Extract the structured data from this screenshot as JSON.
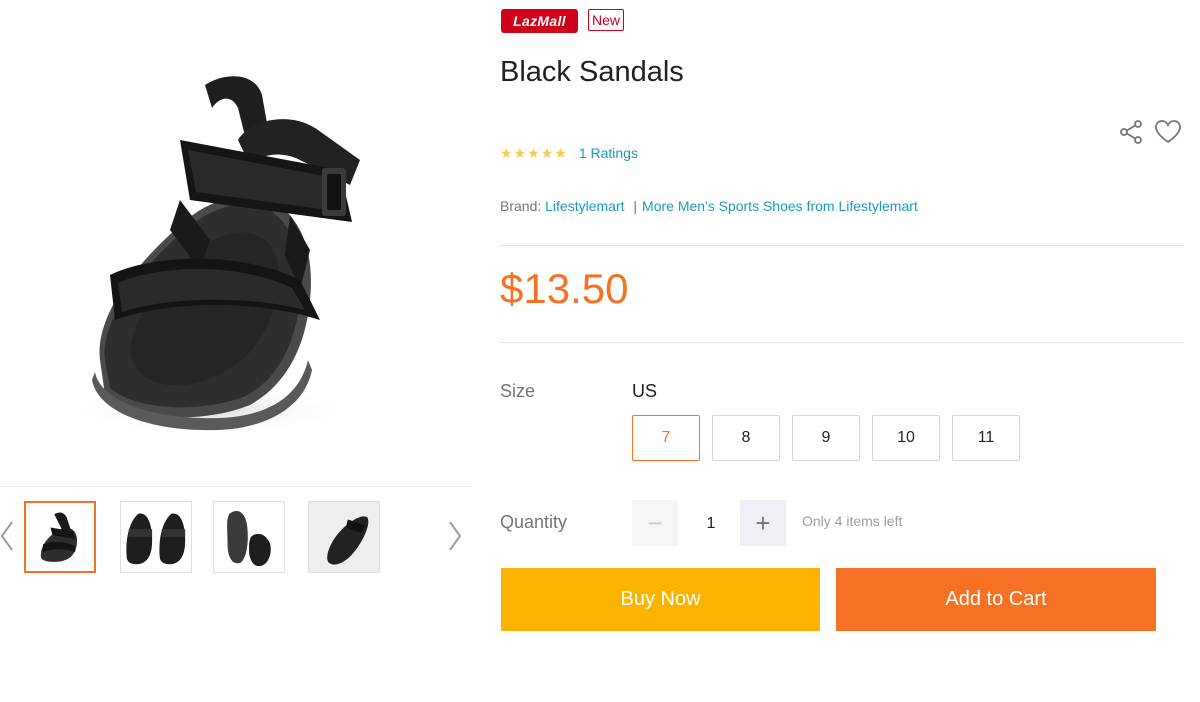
{
  "badges": {
    "lazmall": "LazMall",
    "new": "New"
  },
  "product": {
    "title": "Black Sandals",
    "rating_count": "1 Ratings",
    "stars": 5,
    "brand_label": "Brand:",
    "brand_name": "Lifestylemart",
    "brand_separator": "|",
    "more_link": "More Men's Sports Shoes from Lifestylemart",
    "price": "$13.50"
  },
  "size": {
    "label": "Size",
    "system": "US",
    "options": [
      "7",
      "8",
      "9",
      "10",
      "11"
    ],
    "selected": "7"
  },
  "quantity": {
    "label": "Quantity",
    "value": "1",
    "minus": "−",
    "plus": "+",
    "stock_note": "Only 4 items left"
  },
  "actions": {
    "buy_now": "Buy Now",
    "add_to_cart": "Add to Cart"
  },
  "icons": {
    "share": "share-icon",
    "wishlist": "heart-icon",
    "prev": "chevron-left-icon",
    "next": "chevron-right-icon",
    "star": "star-icon"
  },
  "colors": {
    "accent": "#f57224",
    "buy": "#fcb400",
    "link": "#1a9cb7",
    "lazmall": "#d0011b",
    "star": "#faca51"
  }
}
